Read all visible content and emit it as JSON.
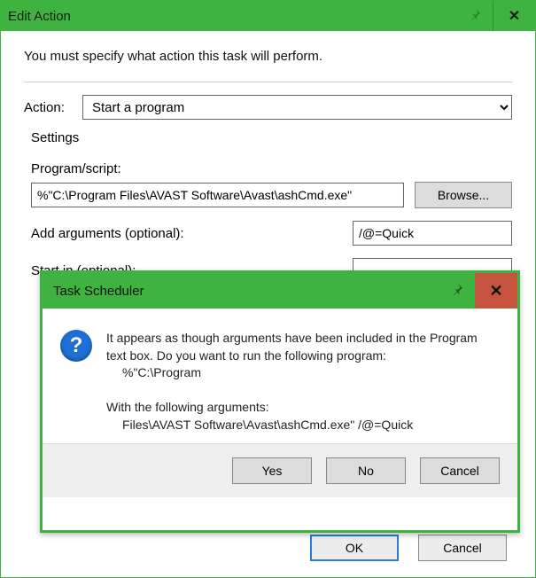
{
  "editAction": {
    "title": "Edit Action",
    "instruction": "You must specify what action this task will perform.",
    "actionLabel": "Action:",
    "actionValue": "Start a program",
    "settingsHeader": "Settings",
    "programLabel": "Program/script:",
    "programValue": "%\"C:\\Program Files\\AVAST Software\\Avast\\ashCmd.exe\"",
    "browseLabel": "Browse...",
    "argsLabel": "Add arguments (optional):",
    "argsValue": "/@=Quick",
    "startInLabel": "Start in (optional):",
    "startInValue": "",
    "okLabel": "OK",
    "cancelLabel": "Cancel"
  },
  "taskScheduler": {
    "title": "Task Scheduler",
    "msgLine1": "It appears as though arguments have been included in the Program text box. Do you want to run the following program:",
    "msgProgram": "%\"C:\\Program",
    "msgLine2": "With the following arguments:",
    "msgArgs": "Files\\AVAST Software\\Avast\\ashCmd.exe\" /@=Quick",
    "yes": "Yes",
    "no": "No",
    "cancel": "Cancel"
  }
}
